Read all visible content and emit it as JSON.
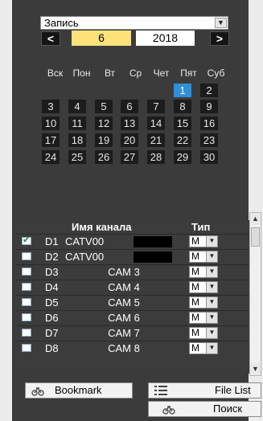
{
  "header": {
    "mode_value": "Запись",
    "prev_label": "<",
    "next_label": ">",
    "month": "6",
    "year": "2018"
  },
  "calendar": {
    "weekdays": [
      "Вск",
      "Пон",
      "Вт",
      "Ср",
      "Чет",
      "Пят",
      "Суб"
    ],
    "weeks": [
      [
        "",
        "",
        "",
        "",
        "",
        "1",
        "2"
      ],
      [
        "3",
        "4",
        "5",
        "6",
        "7",
        "8",
        "9"
      ],
      [
        "10",
        "11",
        "12",
        "13",
        "14",
        "15",
        "16"
      ],
      [
        "17",
        "18",
        "19",
        "20",
        "21",
        "22",
        "23"
      ],
      [
        "24",
        "25",
        "26",
        "27",
        "28",
        "29",
        "30"
      ]
    ],
    "selected": "1"
  },
  "channels": {
    "headers": {
      "name": "Имя канала",
      "type": "Тип"
    },
    "rows": [
      {
        "id": "D1",
        "name": "CATV00",
        "redacted": true,
        "checked": true,
        "type": "M"
      },
      {
        "id": "D2",
        "name": "CATV00",
        "redacted": true,
        "checked": false,
        "type": "M"
      },
      {
        "id": "D3",
        "name": "CAM 3",
        "redacted": false,
        "checked": false,
        "type": "M"
      },
      {
        "id": "D4",
        "name": "CAM 4",
        "redacted": false,
        "checked": false,
        "type": "M"
      },
      {
        "id": "D5",
        "name": "CAM 5",
        "redacted": false,
        "checked": false,
        "type": "M"
      },
      {
        "id": "D6",
        "name": "CAM 6",
        "redacted": false,
        "checked": false,
        "type": "M"
      },
      {
        "id": "D7",
        "name": "CAM 7",
        "redacted": false,
        "checked": false,
        "type": "M"
      },
      {
        "id": "D8",
        "name": "CAM 8",
        "redacted": false,
        "checked": false,
        "type": "M"
      }
    ]
  },
  "buttons": {
    "bookmark": "Bookmark",
    "file_list": "File List",
    "search": "Поиск"
  },
  "colors": {
    "panel_bg": "#3b3b3b",
    "cell_bg": "#1c1c1c",
    "selected_day": "#2f8fd8",
    "month_highlight": "#fde27a"
  }
}
